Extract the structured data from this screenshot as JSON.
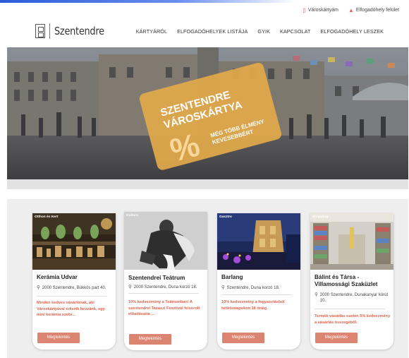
{
  "utility": {
    "items": [
      {
        "icon": "card-icon",
        "label": "Városkártyám"
      },
      {
        "icon": "chart-icon",
        "label": "Elfogadóhely felület"
      }
    ]
  },
  "header": {
    "logo_text": "Szentendre",
    "nav": [
      "KÁRTYÁRÓL",
      "ELFOGADÓHELYEK LISTÁJA",
      "GYIK",
      "KAPCSOLAT",
      "ELFOGADÓHELY LESZEK"
    ]
  },
  "hero": {
    "card_title_line1": "SZENTENDRE",
    "card_title_line2": "VÁROSKÁRTYA",
    "card_symbol": "%",
    "card_tag_line1": "MÉG TÖBB ÉLMÉNY",
    "card_tag_line2": "KEVESEBBÉRT",
    "colors": {
      "card": "#e2a94a",
      "card_text": "#ffffff"
    }
  },
  "cards": [
    {
      "category": "Otthon és Kert",
      "title": "Kerámia Udvar",
      "address": "2000 Szentendre, Bükkös part 40.",
      "description": "Minden kedves vásárlónak, aki Városkártyával érkezik hozzánk, egy mini kerámia szobr...",
      "button": "Megtekintés"
    },
    {
      "category": "Kultúra",
      "title": "Szentendrei Teátrum",
      "address": "2000 Szentendre, Duna korzó 18.",
      "description": "10% kedvezmény a Teátrumban! A szentendrei Tavaszi Fesztivál felsorolt előadásaira ...",
      "button": "Megtekintés"
    },
    {
      "category": "Gasztro",
      "title": "Barlang",
      "address": "Szentendre, Duna korzó 18.",
      "description": "10% kedvezmény a fogyasztásból hétköznapokon 18 óráig.",
      "button": "Megtekintés"
    },
    {
      "category": "Shopping",
      "title": "Bálint és Társa - Villamossági Szaküzlet",
      "address": "2000 Szentendre, Dunakanyar körút 10.",
      "description": "Termék vásárlás esetén 5% kedvezmény a vásárlás összegéből.",
      "button": "Megtekintés"
    }
  ],
  "colors": {
    "accent": "#dc8472",
    "desc_text": "#e0614a"
  }
}
